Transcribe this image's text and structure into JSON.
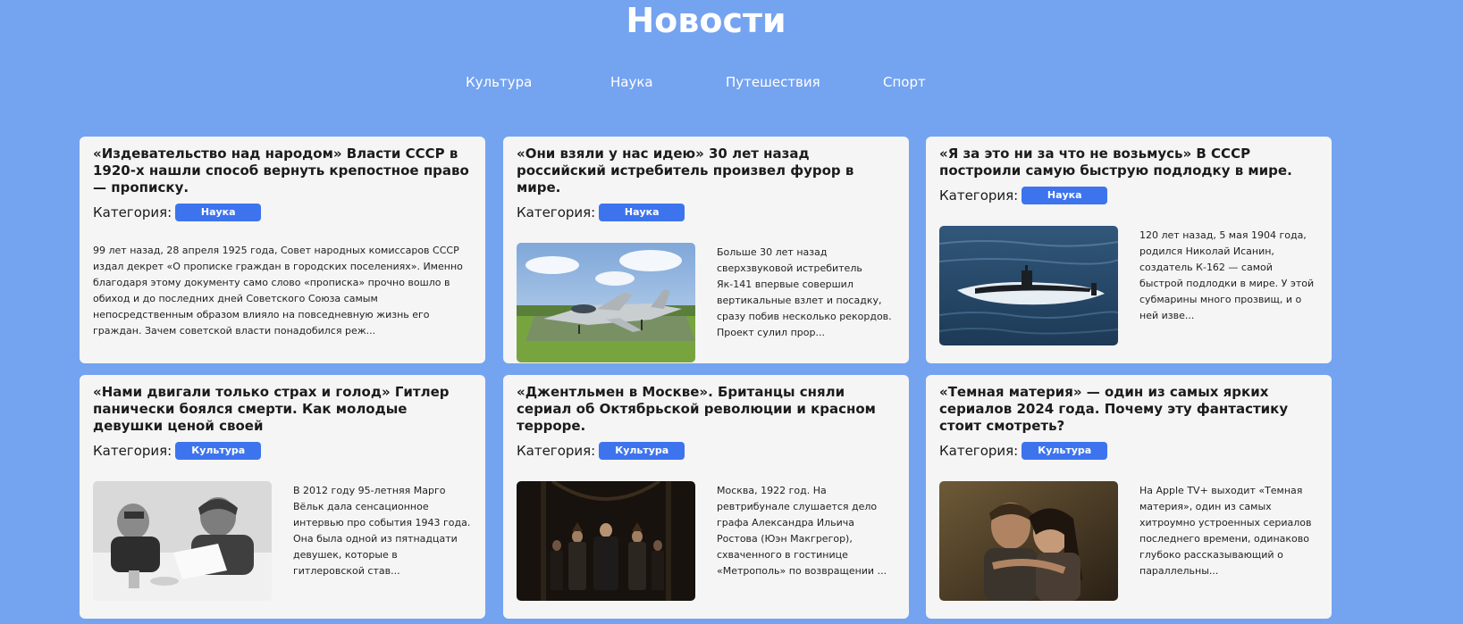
{
  "header": {
    "title": "Новости"
  },
  "nav": [
    {
      "label": "Культура"
    },
    {
      "label": "Наука"
    },
    {
      "label": "Путешествия"
    },
    {
      "label": "Спорт"
    }
  ],
  "category_label": "Категория:",
  "cards": [
    {
      "title": "«Издевательство над народом» Власти СССР в 1920-х нашли способ вернуть крепостное право — прописку.",
      "category": "Наука",
      "excerpt": "99 лет назад, 28 апреля 1925 года, Совет народных комиссаров СССР издал декрет «О прописке граждан в городских поселениях». Именно благодаря этому документу само слово «прописка» прочно вошло в обиход и до последних дней Советского Союза самым непосредственным образом влияло на повседневную жизнь его граждан. Зачем советской власти понадобился реж..."
    },
    {
      "title": "«Они взяли у нас идею» 30 лет назад российский истребитель произвел фурор в мире.",
      "category": "Наука",
      "excerpt": "Больше 30 лет назад сверхзвуковой истребитель Як-141 впервые совершил вертикальные взлет и посадку, сразу побив несколько рекордов. Проект сулил прор...",
      "image": "fighter-jet-photo"
    },
    {
      "title": "«Я за это ни за что не возьмусь» В СССР построили самую быструю подлодку в мире.",
      "category": "Наука",
      "excerpt": "120 лет назад, 5 мая 1904 года, родился Николай Исанин, создатель К-162 — самой быстрой подлодки в мире. У этой субмарины много прозвищ, и о ней изве...",
      "image": "submarine-photo"
    },
    {
      "title": "«Нами двигали только страх и голод» Гитлер панически боялся смерти. Как молодые девушки ценой своей",
      "category": "Культура",
      "excerpt": "В 2012 году 95-летняя Марго Вёльк дала сенсационное интервью про события 1943 года. Она была одной из пятнадцати девушек, которые в гитлеровской став...",
      "image": "historical-bw-photo"
    },
    {
      "title": "«Джентльмен в Москве». Британцы сняли сериал об Октябрьской революции и красном терроре.",
      "category": "Культура",
      "excerpt": "Москва, 1922 год. На ревтрибунале слушается дело графа Александра Ильича Ростова (Юэн Макгрегор), схваченного в гостинице «Метрополь» по возвращении ...",
      "image": "tv-series-still-photo"
    },
    {
      "title": "«Темная материя» — один из самых ярких сериалов 2024 года. Почему эту фантастику стоит смотреть?",
      "category": "Культура",
      "excerpt": "На Apple TV+ выходит «Темная материя», один из самых хитроумно устроенных сериалов последнего времени, одинаково глубоко рассказывающий о параллельны...",
      "image": "couple-embrace-photo"
    }
  ]
}
